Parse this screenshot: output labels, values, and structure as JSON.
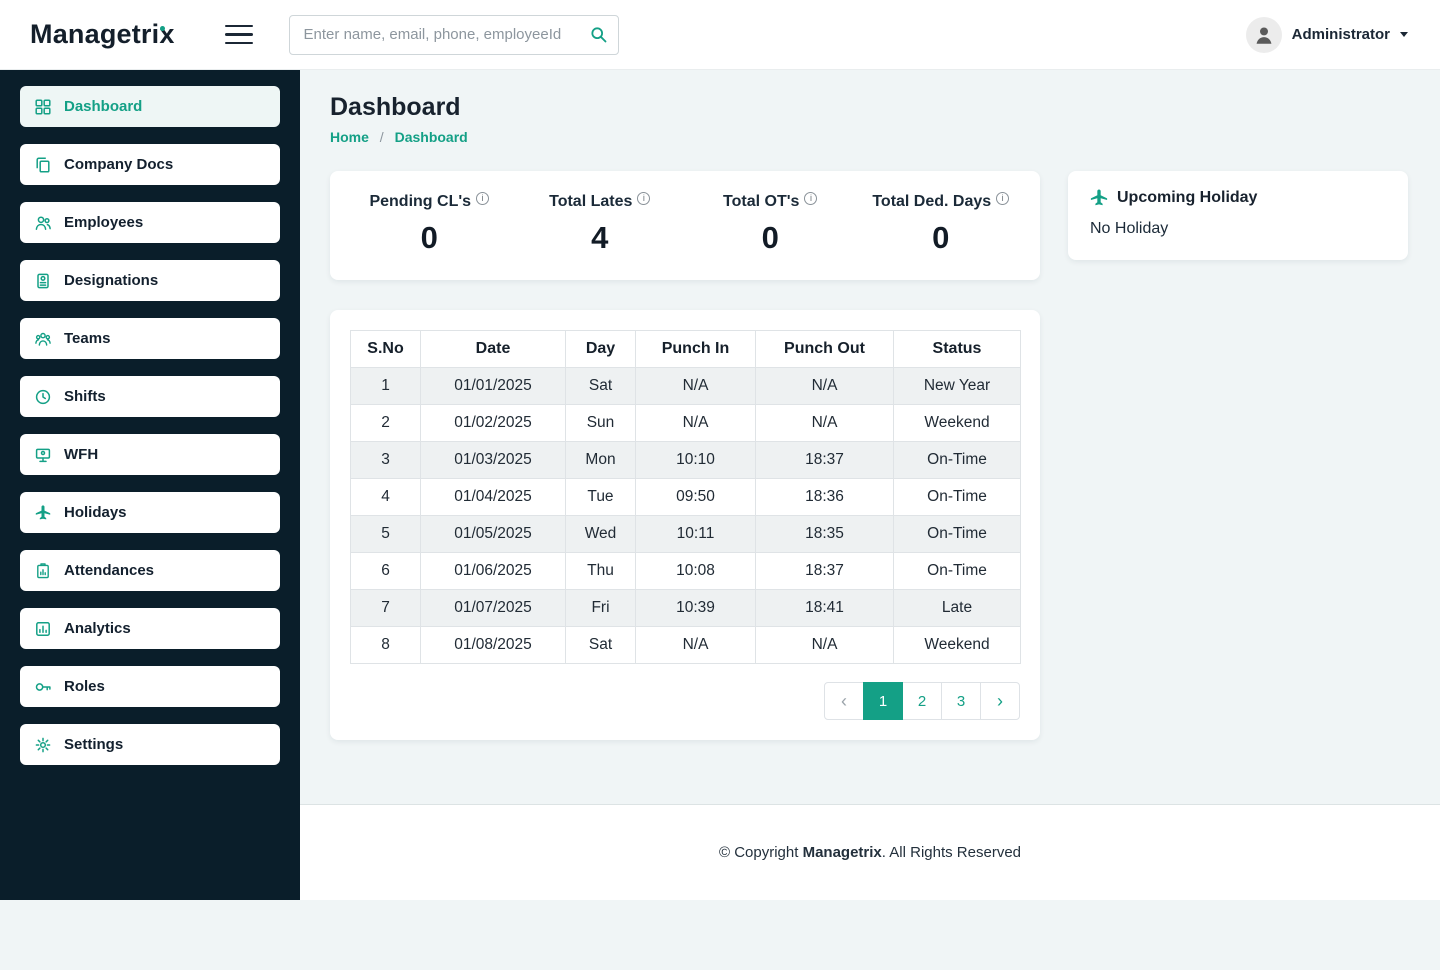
{
  "header": {
    "logo": "Managetrix",
    "search_placeholder": "Enter name, email, phone, employeeId",
    "user": "Administrator"
  },
  "sidebar": {
    "items": [
      {
        "label": "Dashboard",
        "icon": "grid-icon",
        "active": true
      },
      {
        "label": "Company Docs",
        "icon": "documents-icon",
        "active": false
      },
      {
        "label": "Employees",
        "icon": "people-icon",
        "active": false
      },
      {
        "label": "Designations",
        "icon": "id-badge-icon",
        "active": false
      },
      {
        "label": "Teams",
        "icon": "team-icon",
        "active": false
      },
      {
        "label": "Shifts",
        "icon": "clock-icon",
        "active": false
      },
      {
        "label": "WFH",
        "icon": "monitor-icon",
        "active": false
      },
      {
        "label": "Holidays",
        "icon": "plane-icon",
        "active": false
      },
      {
        "label": "Attendances",
        "icon": "clipboard-chart-icon",
        "active": false
      },
      {
        "label": "Analytics",
        "icon": "bar-chart-icon",
        "active": false
      },
      {
        "label": "Roles",
        "icon": "key-icon",
        "active": false
      },
      {
        "label": "Settings",
        "icon": "gear-icon",
        "active": false
      }
    ]
  },
  "page": {
    "title": "Dashboard",
    "breadcrumb": {
      "home": "Home",
      "sep": "/",
      "current": "Dashboard"
    }
  },
  "stats": [
    {
      "label": "Pending CL's",
      "value": "0"
    },
    {
      "label": "Total Lates",
      "value": "4"
    },
    {
      "label": "Total OT's",
      "value": "0"
    },
    {
      "label": "Total Ded. Days",
      "value": "0"
    }
  ],
  "holiday_card": {
    "title": "Upcoming Holiday",
    "text": "No Holiday"
  },
  "attendance_table": {
    "columns": [
      "S.No",
      "Date",
      "Day",
      "Punch In",
      "Punch Out",
      "Status"
    ],
    "rows": [
      [
        "1",
        "01/01/2025",
        "Sat",
        "N/A",
        "N/A",
        "New Year"
      ],
      [
        "2",
        "01/02/2025",
        "Sun",
        "N/A",
        "N/A",
        "Weekend"
      ],
      [
        "3",
        "01/03/2025",
        "Mon",
        "10:10",
        "18:37",
        "On-Time"
      ],
      [
        "4",
        "01/04/2025",
        "Tue",
        "09:50",
        "18:36",
        "On-Time"
      ],
      [
        "5",
        "01/05/2025",
        "Wed",
        "10:11",
        "18:35",
        "On-Time"
      ],
      [
        "6",
        "01/06/2025",
        "Thu",
        "10:08",
        "18:37",
        "On-Time"
      ],
      [
        "7",
        "01/07/2025",
        "Fri",
        "10:39",
        "18:41",
        "Late"
      ],
      [
        "8",
        "01/08/2025",
        "Sat",
        "N/A",
        "N/A",
        "Weekend"
      ]
    ]
  },
  "pagination": {
    "prev": "‹",
    "pages": [
      "1",
      "2",
      "3"
    ],
    "next": "›",
    "active": "1"
  },
  "footer": {
    "prefix": "© Copyright ",
    "brand": "Managetrix",
    "suffix": ". All Rights Reserved"
  },
  "icons": {
    "info": "i"
  },
  "colors": {
    "accent": "#14a086",
    "sidebar_bg": "#0a1e2a",
    "main_bg": "#f0f5f6",
    "stripe": "#eef1f2"
  }
}
